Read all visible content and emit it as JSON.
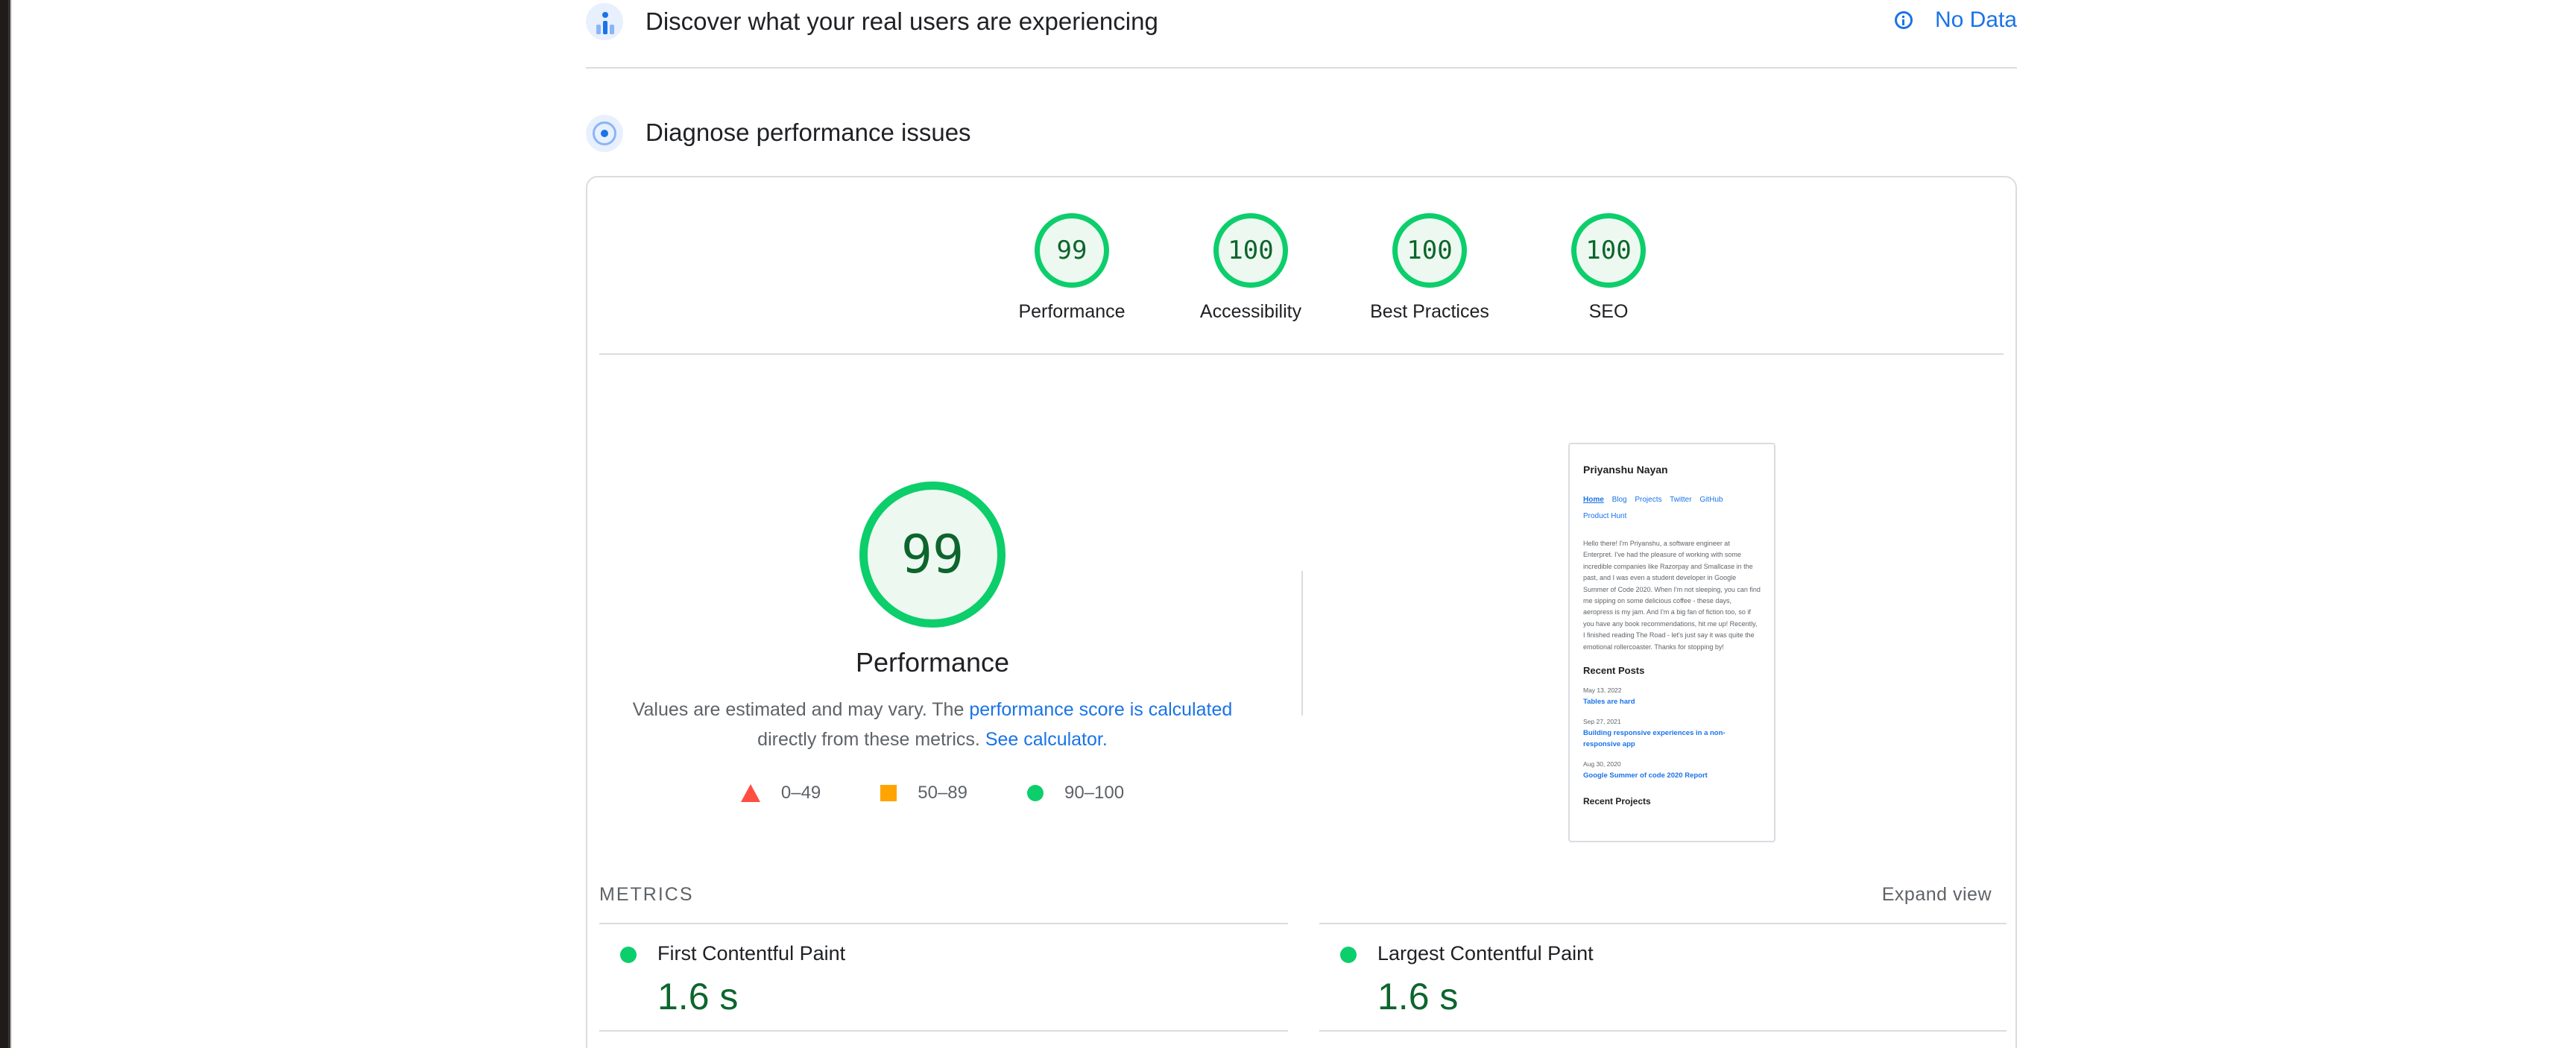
{
  "field_data": {
    "title": "Discover what your real users are experiencing",
    "status": "No Data"
  },
  "diagnose": {
    "title": "Diagnose performance issues"
  },
  "category_scores": [
    {
      "score": "99",
      "label": "Performance"
    },
    {
      "score": "100",
      "label": "Accessibility"
    },
    {
      "score": "100",
      "label": "Best Practices"
    },
    {
      "score": "100",
      "label": "SEO"
    }
  ],
  "performance": {
    "score": "99",
    "label": "Performance",
    "desc_prefix": "Values are estimated and may vary. The ",
    "desc_link1": "performance score is calculated",
    "desc_middle": " directly from these metrics. ",
    "desc_link2": "See calculator."
  },
  "legend": {
    "fail": "0–49",
    "average": "50–89",
    "pass": "90–100"
  },
  "colors": {
    "pass": "#0cce6b",
    "average": "#ffa400",
    "fail": "#ff4e42",
    "link": "#1a73e8"
  },
  "screenshot": {
    "name": "Priyanshu Nayan",
    "nav": [
      "Home",
      "Blog",
      "Projects",
      "Twitter",
      "GitHub",
      "Product Hunt"
    ],
    "bio": "Hello there! I'm Priyanshu, a software engineer at Enterpret. I've had the pleasure of working with some incredible companies like Razorpay and Smallcase in the past, and I was even a student developer in Google Summer of Code 2020. When I'm not sleeping, you can find me sipping on some delicious coffee - these days, aeropress is my jam. And I'm a big fan of fiction too, so if you have any book recommendations, hit me up! Recently, I finished reading The Road - let's just say it was quite the emotional rollercoaster. Thanks for stopping by!",
    "recent_heading": "Recent Posts",
    "posts": [
      {
        "date": "May 13, 2022",
        "title": "Tables are hard"
      },
      {
        "date": "Sep 27, 2021",
        "title": "Building responsive experiences in a non-responsive app"
      },
      {
        "date": "Aug 30, 2020",
        "title": "Google Summer of code 2020 Report"
      }
    ],
    "next_heading": "Recent Projects"
  },
  "metrics": {
    "label": "METRICS",
    "expand": "Expand view",
    "items": [
      {
        "name": "First Contentful Paint",
        "value": "1.6 s"
      },
      {
        "name": "Largest Contentful Paint",
        "value": "1.6 s"
      }
    ]
  }
}
